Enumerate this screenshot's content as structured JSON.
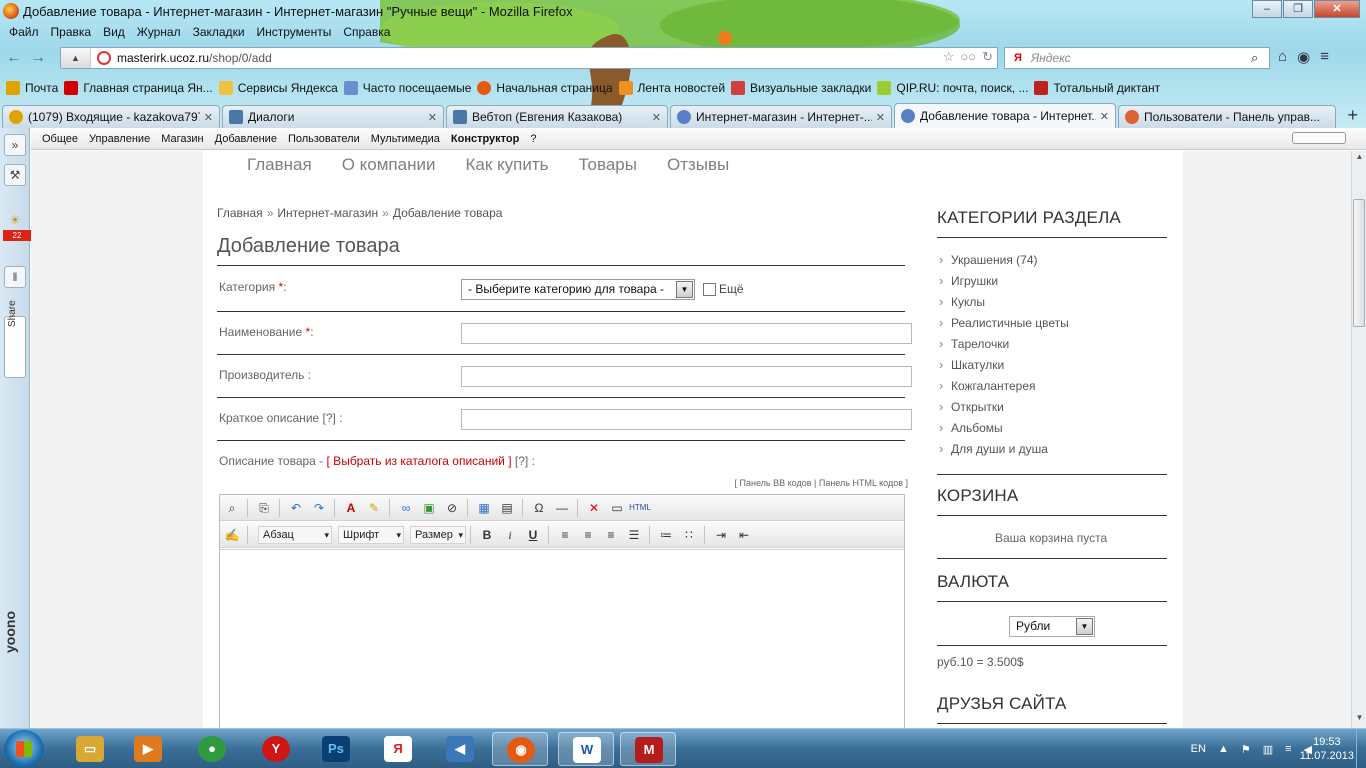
{
  "window": {
    "title": "Добавление товара - Интернет-магазин - Интернет-магазин \"Ручные вещи\" - Mozilla Firefox",
    "controls": [
      "–",
      "❐",
      "✕"
    ]
  },
  "menu": [
    "Файл",
    "Правка",
    "Вид",
    "Журнал",
    "Закладки",
    "Инструменты",
    "Справка"
  ],
  "address": {
    "domain": "masterirk.ucoz.ru",
    "path": "/shop/0/add"
  },
  "search": {
    "engine": "Я",
    "placeholder": "Яндекс"
  },
  "bookmarks": [
    {
      "label": "Почта",
      "color": "#e0a400"
    },
    {
      "label": "Главная страница Ян...",
      "color": "#d00000"
    },
    {
      "label": "Сервисы Яндекса",
      "color": "#f0c040"
    },
    {
      "label": "Часто посещаемые",
      "color": "#6a8fd0"
    },
    {
      "label": "Начальная страница",
      "color": "#e35b12"
    },
    {
      "label": "Лента новостей",
      "color": "#f09020"
    },
    {
      "label": "Визуальные закладки",
      "color": "#d04040"
    },
    {
      "label": "QIP.RU: почта, поиск, ...",
      "color": "#9acd32"
    },
    {
      "label": "Тотальный диктант",
      "color": "#c02020"
    }
  ],
  "tabs": [
    {
      "label": "(1079) Входящие - kazakova797...",
      "color": "#e0a400"
    },
    {
      "label": "Диалоги",
      "color": "#4a76a8"
    },
    {
      "label": "Вебтоп (Евгения Казакова)",
      "color": "#4a76a8"
    },
    {
      "label": "Интернет-магазин - Интернет-...",
      "color": "#5b7fc7"
    },
    {
      "label": "Добавление товара - Интернет...",
      "color": "#5b7fc7"
    },
    {
      "label": "Пользователи - Панель управ...",
      "color": "#e06030"
    }
  ],
  "sidebar": {
    "badge": "22",
    "share": "Share",
    "brand": "yoono"
  },
  "admin_menu": [
    "Общее",
    "Управление",
    "Магазин",
    "Добавление",
    "Пользователи",
    "Мультимедиа",
    "Конструктор",
    "?"
  ],
  "site_nav": [
    "Главная",
    "О компании",
    "Как купить",
    "Товары",
    "Отзывы"
  ],
  "breadcrumb": [
    "Главная",
    "Интернет-магазин",
    "Добавление товара"
  ],
  "breadcrumb_sep": "»",
  "page_title": "Добавление товара",
  "form": {
    "category_label": "Категория",
    "name_label": "Наименование",
    "required_mark": "*",
    "colon": ":",
    "producer_label": "Производитель :",
    "short_desc_label": "Краткое описание",
    "help_mark": "[?]",
    "category_select": "- Выберите категорию для товара -",
    "more_label": "Ещё",
    "desc_label": "Описание товара",
    "desc_link": "[ Выбрать из каталога описаний ]",
    "panel_links": "[ Панель BB кодов | Панель HTML кодов ]",
    "editor_dropdowns": [
      "Абзац",
      "Шрифт",
      "Размер"
    ]
  },
  "right": {
    "categories_title": "КАТЕГОРИИ РАЗДЕЛА",
    "categories": [
      "Украшения (74)",
      "Игрушки",
      "Куклы",
      "Реалистичные цветы",
      "Тарелочки",
      "Шкатулки",
      "Кожгалантерея",
      "Открытки",
      "Альбомы",
      "Для души и душа"
    ],
    "cart_title": "КОРЗИНА",
    "cart_empty": "Ваша корзина пуста",
    "currency_title": "ВАЛЮТА",
    "currency_value": "Рубли",
    "currency_rate": "руб.10 = 3.500$",
    "friends_title": "ДРУЗЬЯ САЙТА"
  },
  "taskbar": {
    "lang": "EN",
    "time": "19:53",
    "date": "11.07.2013",
    "apps": [
      {
        "name": "explorer",
        "glyph": "▭",
        "color": "#d9a833"
      },
      {
        "name": "media",
        "glyph": "▶",
        "color": "#e07a20"
      },
      {
        "name": "chrome",
        "glyph": "●",
        "color": "#2e9b3f"
      },
      {
        "name": "yandex-browser",
        "glyph": "Y",
        "color": "#d01515"
      },
      {
        "name": "photoshop",
        "glyph": "Ps",
        "color": "#0b3f73"
      },
      {
        "name": "yandex",
        "glyph": "Я",
        "color": "#e02020"
      },
      {
        "name": "audio",
        "glyph": "◀",
        "color": "#3b78b8"
      },
      {
        "name": "firefox",
        "glyph": "◉",
        "color": "#e35b12"
      },
      {
        "name": "word",
        "glyph": "W",
        "color": "#1d55a8"
      },
      {
        "name": "mcafee",
        "glyph": "M",
        "color": "#b71c1c"
      }
    ]
  }
}
